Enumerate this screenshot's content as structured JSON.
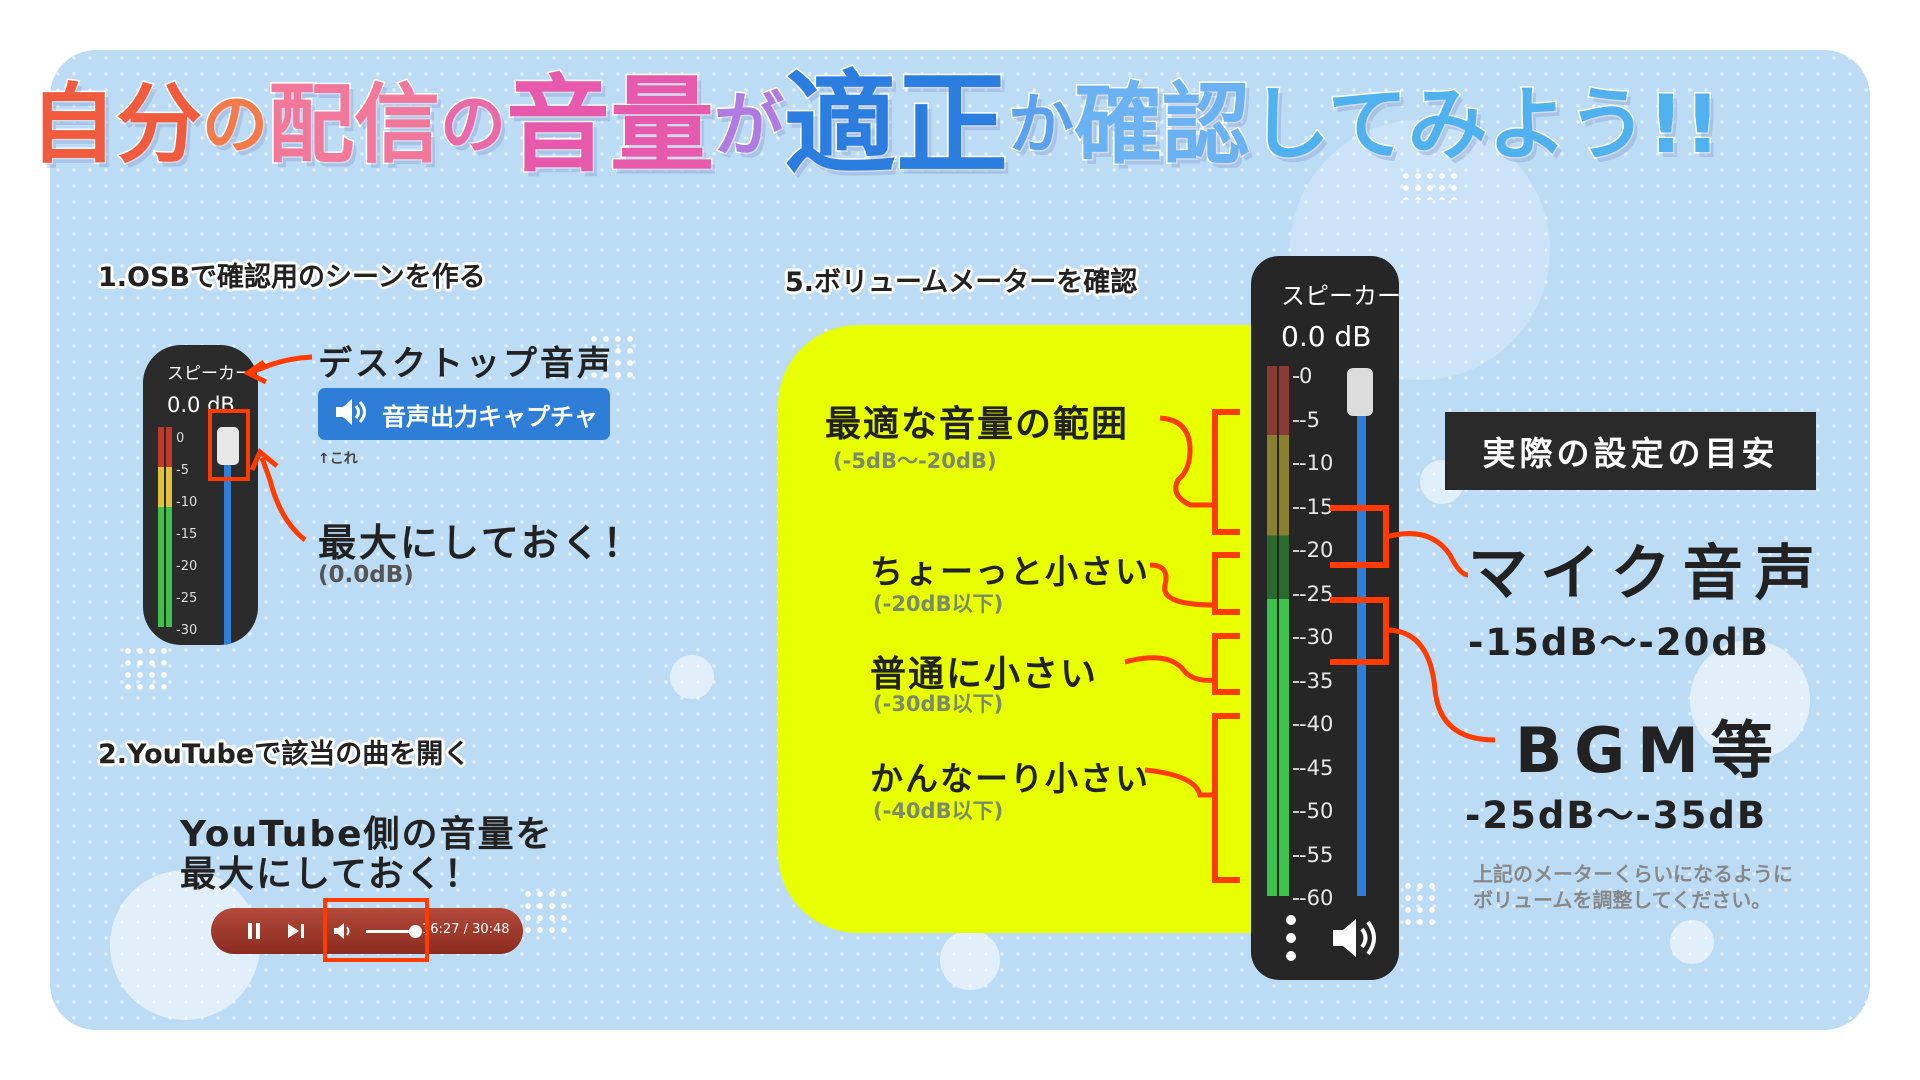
{
  "title": {
    "segments": [
      {
        "text": "自分",
        "color": "#ef5b3c",
        "size": 86
      },
      {
        "text": "の",
        "color": "#f27b4c",
        "size": 66
      },
      {
        "text": "配信",
        "color": "#f1789a",
        "size": 86
      },
      {
        "text": "の",
        "color": "#e96aa8",
        "size": 66
      },
      {
        "text": "音量",
        "color": "#e659ad",
        "size": 104
      },
      {
        "text": "が",
        "color": "#b07be0",
        "size": 70
      },
      {
        "text": "適正",
        "color": "#2b7de0",
        "size": 112
      },
      {
        "text": "か",
        "color": "#5aa2ee",
        "size": 66
      },
      {
        "text": "確認",
        "color": "#6ab2f2",
        "size": 88
      },
      {
        "text": "してみよう!!",
        "color": "#4fb2ef",
        "size": 80
      }
    ]
  },
  "step1": {
    "heading": "1.OSBで確認用のシーンを作る",
    "meter": {
      "name": "スピーカー",
      "db": "0.0 dB",
      "ticks": [
        "0",
        "-5",
        "-10",
        "-15",
        "-20",
        "-25",
        "-30"
      ]
    },
    "desktop_audio": "デスクトップ音声",
    "capture_button": "音声出力キャプチャ",
    "speaker_icon": "speaker-icon",
    "this_note": "↑これ",
    "set_max": "最大にしておく！",
    "set_max_value": "(0.0dB)"
  },
  "step2": {
    "heading": "2.YouTubeで該当の曲を開く",
    "instruction_line1": "YouTube側の音量を",
    "instruction_line2": "最大にしておく！",
    "player": {
      "time": "16:27 / 30:48",
      "volume_fraction": 1.0,
      "icons": [
        "pause-icon",
        "next-icon",
        "volume-icon"
      ]
    }
  },
  "step5": {
    "heading": "5.ボリュームメーターを確認",
    "ranges": [
      {
        "label": "最適な音量の範囲",
        "value": "(-5dB〜-20dB)"
      },
      {
        "label": "ちょーっと小さい",
        "value": "(-20dB以下)"
      },
      {
        "label": "普通に小さい",
        "value": "(-30dB以下)"
      },
      {
        "label": "かんなーり小さい",
        "value": "(-40dB以下)"
      }
    ],
    "meter": {
      "name": "スピーカー",
      "db": "0.0 dB",
      "ticks": [
        "0",
        "-5",
        "-10",
        "-15",
        "-20",
        "-25",
        "-30",
        "-35",
        "-40",
        "-45",
        "-50",
        "-55",
        "-60"
      ]
    }
  },
  "guide": {
    "box_title": "実際の設定の目安",
    "mic_label": "マイク音声",
    "mic_range": "-15dB〜-20dB",
    "bgm_label": "BGM等",
    "bgm_range": "-25dB〜-35dB",
    "note_line1": "上記のメーターくらいになるように",
    "note_line2": "ボリュームを調整してください。"
  },
  "colors": {
    "highlight": "#ff3b00",
    "meter_blue": "#2f7fd8",
    "yellow": "#e7ff00"
  }
}
